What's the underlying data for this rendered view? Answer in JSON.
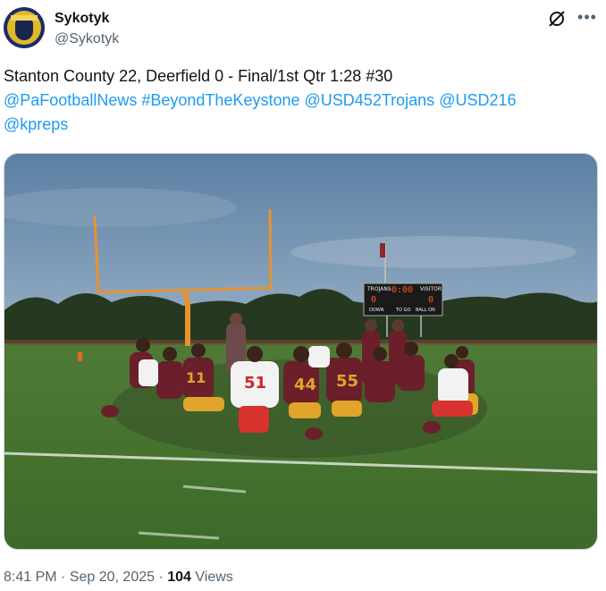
{
  "author": {
    "display_name": "Sykotyk",
    "handle": "@Sykotyk"
  },
  "icons": {
    "avatar": "avatar-image",
    "grok": "grok-icon",
    "more": "more-options-icon"
  },
  "tweet": {
    "text_plain": "Stanton County 22, Deerfield 0 - Final/1st Qtr 1:28 #30",
    "mentions": [
      "@PaFootballNews",
      "#BeyondTheKeystone",
      "@USD452Trojans",
      "@USD216",
      "@kpreps"
    ]
  },
  "media": {
    "scoreboard": {
      "home_name": "TROJANS",
      "visitor_name": "VISITOR",
      "home_score": "0",
      "visitor_score": "0",
      "clock": "0:00",
      "labels": [
        "DOWN",
        "TO GO",
        "BALL ON"
      ]
    },
    "jersey_numbers": [
      "11",
      "51",
      "44",
      "55"
    ]
  },
  "footer": {
    "time": "8:41 PM",
    "separator": " · ",
    "date": "Sep 20, 2025",
    "views_count": "104",
    "views_label": "Views"
  },
  "colors": {
    "link": "#1d9bf0",
    "secondary_text": "#536471",
    "primary_text": "#0f1419",
    "trojans_maroon": "#6b1f2a",
    "trojans_gold": "#e0a52a"
  }
}
